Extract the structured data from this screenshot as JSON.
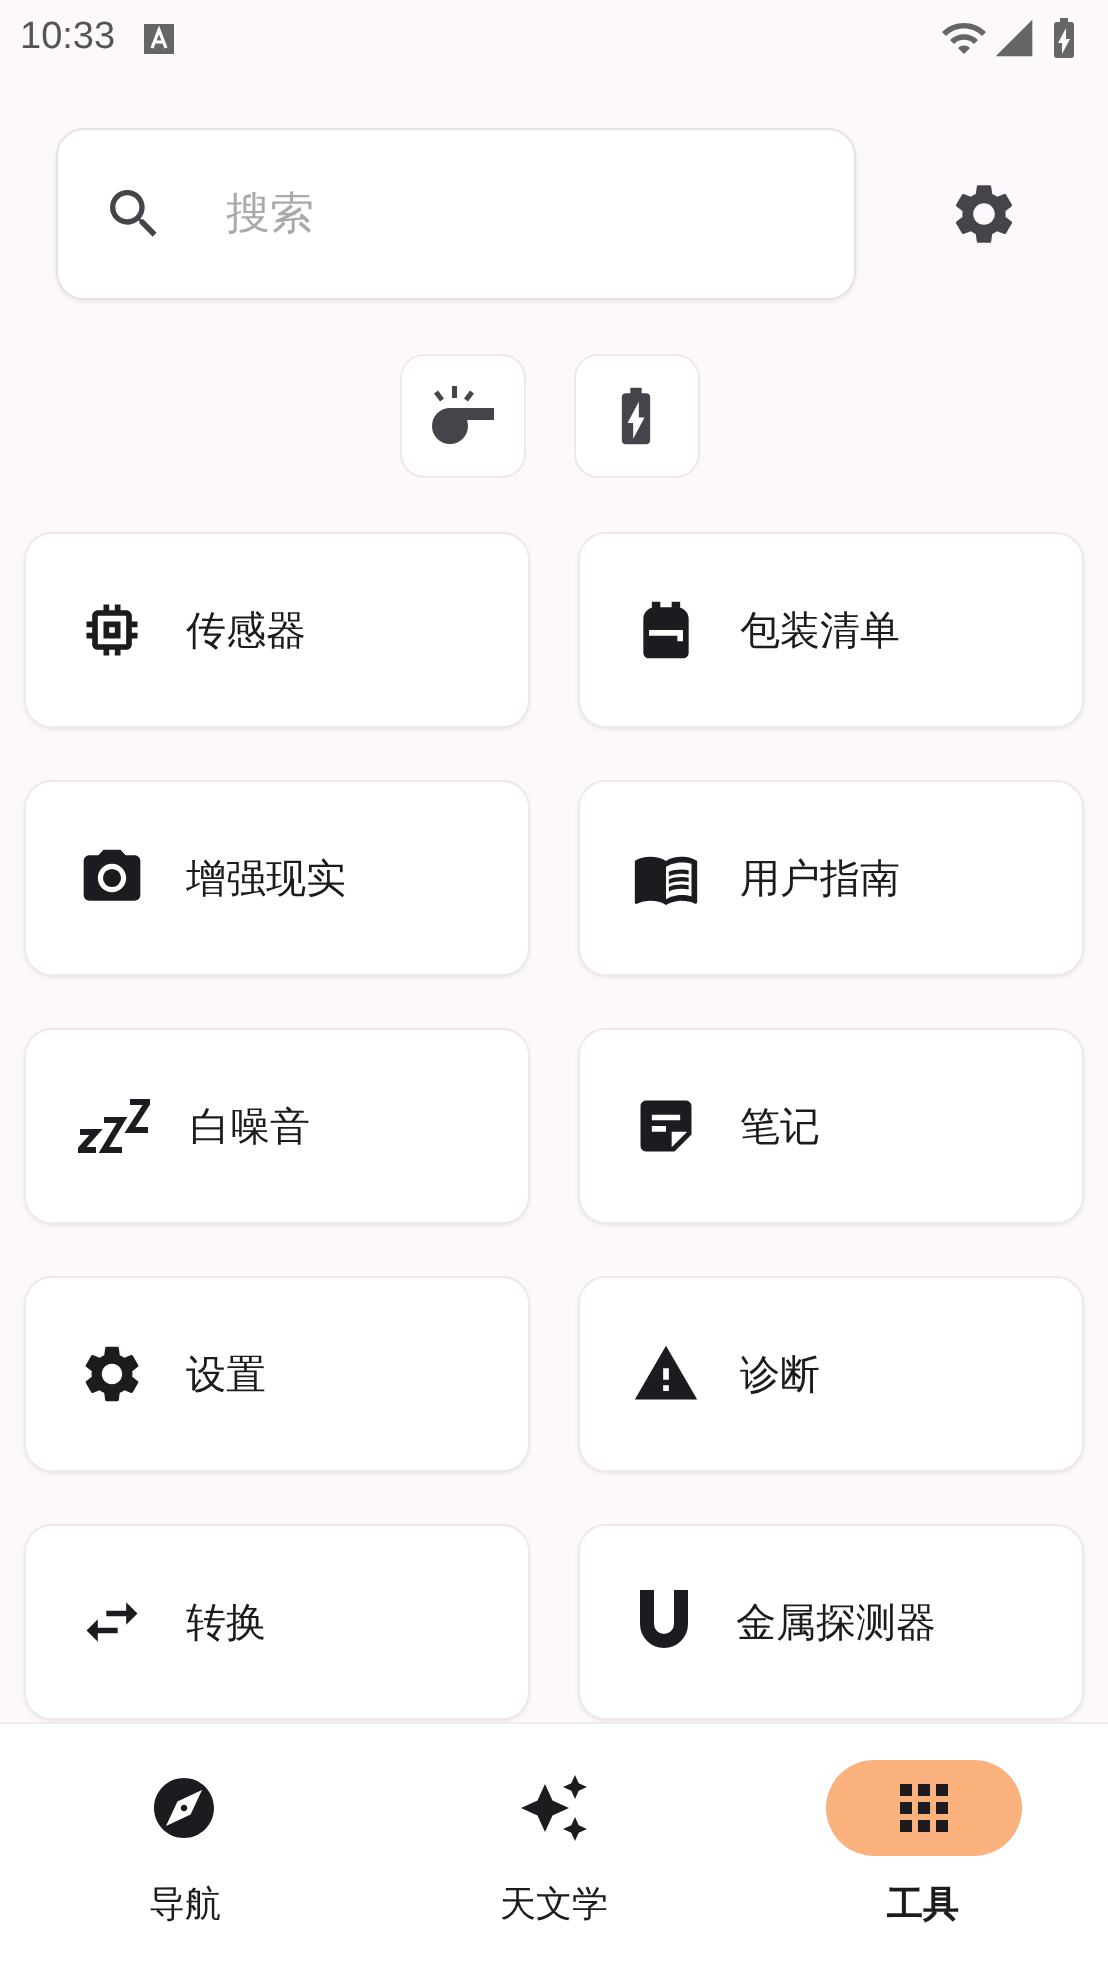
{
  "status_bar": {
    "time": "10:33"
  },
  "search": {
    "placeholder": "搜索"
  },
  "tools": [
    {
      "label": "传感器"
    },
    {
      "label": "包装清单"
    },
    {
      "label": "增强现实"
    },
    {
      "label": "用户指南"
    },
    {
      "label": "白噪音"
    },
    {
      "label": "笔记"
    },
    {
      "label": "设置"
    },
    {
      "label": "诊断"
    },
    {
      "label": "转换"
    },
    {
      "label": "金属探测器"
    }
  ],
  "bottom_nav": [
    {
      "label": "导航",
      "selected": false
    },
    {
      "label": "天文学",
      "selected": false
    },
    {
      "label": "工具",
      "selected": true
    }
  ]
}
